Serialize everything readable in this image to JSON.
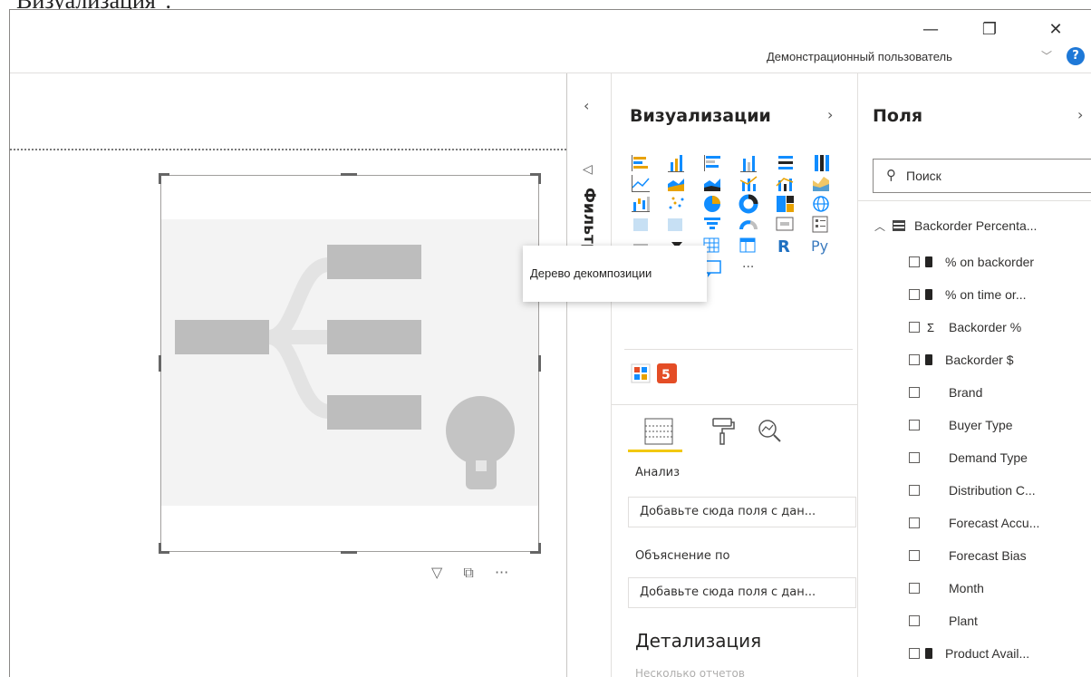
{
  "caption": "Визуализация\".",
  "window": {
    "user_name": "Демонстрационный пользователь",
    "minimize_glyph": "—",
    "restore_glyph": "❐",
    "close_glyph": "✕",
    "help_glyph": "?"
  },
  "filters_pane": {
    "label": "Фильтры",
    "collapse_glyph": "‹"
  },
  "visualizations_pane": {
    "title": "Визуализации",
    "expand_glyph": "›",
    "tooltip": "Дерево декомпозиции",
    "more_glyph": "···",
    "wells": [
      {
        "label": "Анализ",
        "placeholder": "Добавьте сюда поля с дан..."
      },
      {
        "label": "Объяснение по",
        "placeholder": "Добавьте сюда поля с дан..."
      }
    ],
    "section_heading": "Детализация",
    "section_sub": "Несколько отчетов"
  },
  "fields_pane": {
    "title": "Поля",
    "expand_glyph": "›",
    "search_placeholder": "Поиск",
    "table_name": "Backorder Percenta...",
    "fields": [
      {
        "label": "% on backorder",
        "type": "measure"
      },
      {
        "label": "% on time or...",
        "type": "measure"
      },
      {
        "label": "Backorder %",
        "type": "sum"
      },
      {
        "label": "Backorder $",
        "type": "measure"
      },
      {
        "label": "Brand",
        "type": "column"
      },
      {
        "label": "Buyer Type",
        "type": "column"
      },
      {
        "label": "Demand Type",
        "type": "column"
      },
      {
        "label": "Distribution C...",
        "type": "column"
      },
      {
        "label": "Forecast Accu...",
        "type": "column"
      },
      {
        "label": "Forecast Bias",
        "type": "column"
      },
      {
        "label": "Month",
        "type": "column"
      },
      {
        "label": "Plant",
        "type": "column"
      },
      {
        "label": "Product Avail...",
        "type": "measure"
      }
    ]
  },
  "visual_toolbar": {
    "more_glyph": "···"
  },
  "colors": {
    "accent_yellow": "#f2c811",
    "help_blue": "#1e78d7",
    "html_orange": "#e44d26",
    "selected_border": "#252423"
  }
}
